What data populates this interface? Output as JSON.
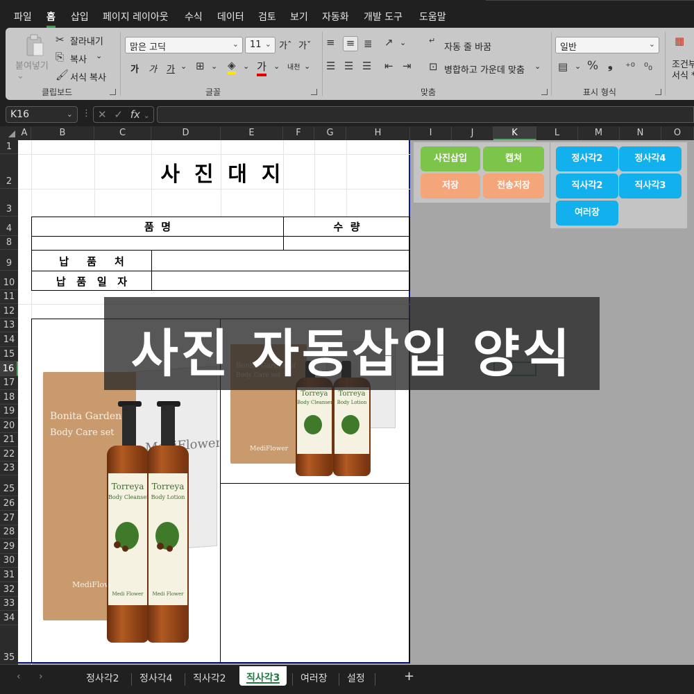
{
  "menu": [
    "파일",
    "홈",
    "삽입",
    "페이지 레이아웃",
    "수식",
    "데이터",
    "검토",
    "보기",
    "자동화",
    "개발 도구",
    "도움말"
  ],
  "ribbon": {
    "clipboard": {
      "paste": "붙여넣기",
      "cut": "잘라내기",
      "copy": "복사",
      "format_painter": "서식 복사",
      "label": "클립보드"
    },
    "font": {
      "font_name": "맑은 고딕",
      "font_size": "11",
      "bold": "가",
      "italic": "가",
      "underline": "가",
      "label": "글꼴"
    },
    "alignment": {
      "wrap_text": "자동 줄 바꿈",
      "merge_center": "병합하고 가운데 맞춤",
      "label": "맞춤"
    },
    "number": {
      "format": "일반",
      "label": "표시 형식"
    },
    "styles": {
      "conditional": "조건부",
      "format_as": "서식 *"
    }
  },
  "formula_bar": {
    "name_box": "K16",
    "fx": "fx",
    "value": ""
  },
  "columns": [
    "A",
    "B",
    "C",
    "D",
    "E",
    "F",
    "G",
    "H",
    "I",
    "J",
    "K",
    "L",
    "M",
    "N",
    "O"
  ],
  "selected_column": "K",
  "rows": [
    "1",
    "2",
    "3",
    "4",
    "8",
    "9",
    "10",
    "11",
    "12",
    "13",
    "14",
    "15",
    "16",
    "17",
    "18",
    "19",
    "20",
    "21",
    "22",
    "23",
    "25",
    "26",
    "27",
    "28",
    "29",
    "30",
    "31",
    "32",
    "33",
    "34",
    "35"
  ],
  "selected_row": "16",
  "sheet": {
    "title": "사  진  대  지",
    "item_header": "품  명",
    "qty_header": "수  량",
    "delivery_to": "납     품     처",
    "delivery_date": "납   품   일   자"
  },
  "photo": {
    "box_line1": "Bonita Garden of",
    "box_line2": "Body Care set",
    "box_brand": "MediFlower",
    "bag_text": "MediFlower",
    "bottle1_title": "Torreya",
    "bottle1_sub": "Body Cleanser",
    "bottle2_title": "Torreya",
    "bottle2_sub": "Body Lotion",
    "bottle_brand": "Medi Flower"
  },
  "macro_buttons": {
    "insert_photo": "사진삽입",
    "capture": "캡쳐",
    "save": "저장",
    "send_save": "전송저장",
    "square2": "정사각2",
    "square4": "정사각4",
    "rect2": "직사각2",
    "rect3": "직사각3",
    "multi": "여러장"
  },
  "colors": {
    "green_btn": "#7dc54a",
    "orange_btn": "#f5a57a",
    "blue_btn": "#12b0ec",
    "sheet_border": "#0a1a8a"
  },
  "overlay_title": "사진 자동삽입 양식",
  "tabs": [
    "정사각2",
    "정사각4",
    "직사각2",
    "직사각3",
    "여러장",
    "설정"
  ],
  "active_tab": "직사각3"
}
